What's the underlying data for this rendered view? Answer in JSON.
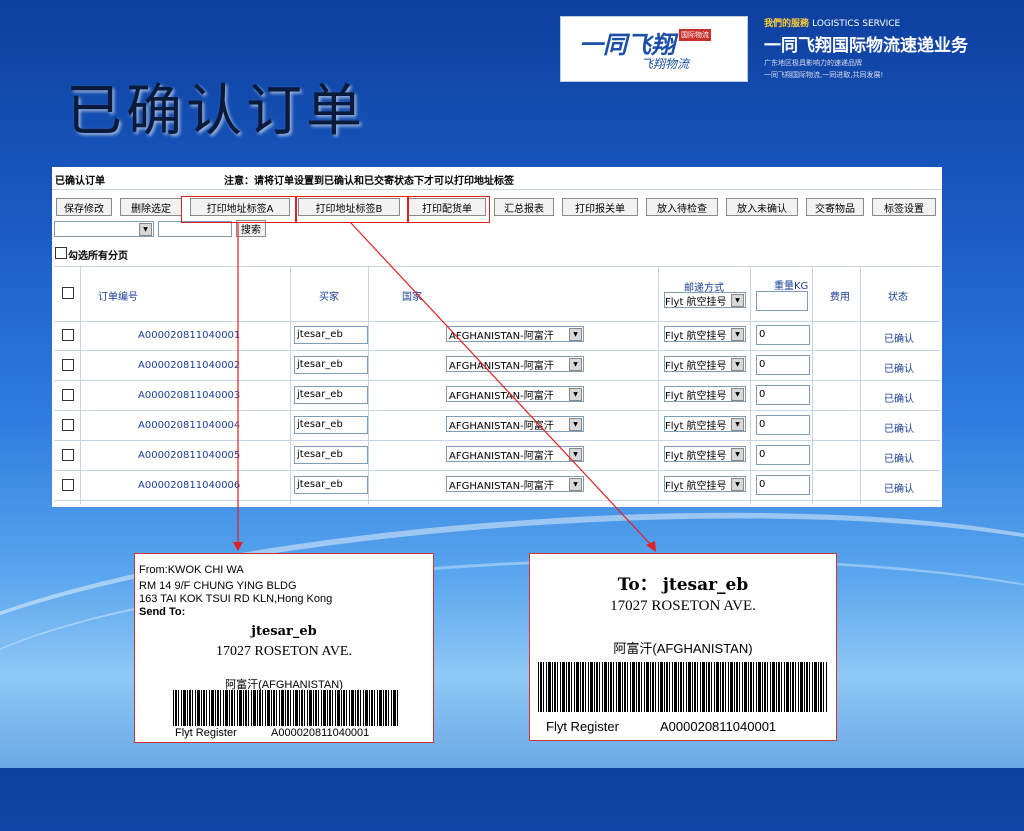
{
  "slide_title": "已确认订单",
  "logo": {
    "main": "一同飞翔",
    "sub": "飞翔物流",
    "tag": "国际物流"
  },
  "brand": {
    "line1": "我們的服務",
    "line1_en": "LOGISTICS SERVICE",
    "line2": "一同飞翔国际物流速递业务",
    "line3": "广东地区极具影响力的速递品牌",
    "line4": "一同飞翔国际物流,一同进取,共同发展!"
  },
  "panel": {
    "title": "已确认订单",
    "notice": "注意：请将订单设置到已确认和已交寄状态下才可以打印地址标签",
    "toolbar": [
      "保存修改",
      "删除选定",
      "打印地址标签A",
      "打印地址标签B",
      "打印配货单",
      "汇总报表",
      "打印报关单",
      "放入待检查",
      "放入未确认",
      "交寄物品",
      "标签设置"
    ],
    "search_button": "搜索",
    "select_all": "勾选所有分页"
  },
  "table": {
    "headers": {
      "order_no": "订单编号",
      "buyer": "买家",
      "country": "国家",
      "shipping": "邮递方式",
      "weight": "重量KG",
      "fee": "费用",
      "status": "状态",
      "shipping_select": "Flyt 航空挂号"
    },
    "rows": [
      {
        "order": "A000020811040001",
        "buyer": "jtesar_eb",
        "country": "AFGHANISTAN-阿富汗",
        "shipping": "Flyt 航空挂号",
        "weight": "0",
        "status": "已确认"
      },
      {
        "order": "A000020811040002",
        "buyer": "jtesar_eb",
        "country": "AFGHANISTAN-阿富汗",
        "shipping": "Flyt 航空挂号",
        "weight": "0",
        "status": "已确认"
      },
      {
        "order": "A000020811040003",
        "buyer": "jtesar_eb",
        "country": "AFGHANISTAN-阿富汗",
        "shipping": "Flyt 航空挂号",
        "weight": "0",
        "status": "已确认"
      },
      {
        "order": "A000020811040004",
        "buyer": "jtesar_eb",
        "country": "AFGHANISTAN-阿富汗",
        "shipping": "Flyt 航空挂号",
        "weight": "0",
        "status": "已确认"
      },
      {
        "order": "A000020811040005",
        "buyer": "jtesar_eb",
        "country": "AFGHANISTAN-阿富汗",
        "shipping": "Flyt 航空挂号",
        "weight": "0",
        "status": "已确认"
      },
      {
        "order": "A000020811040006",
        "buyer": "jtesar_eb",
        "country": "AFGHANISTAN-阿富汗",
        "shipping": "Flyt 航空挂号",
        "weight": "0",
        "status": "已确认"
      }
    ]
  },
  "label_a": {
    "from": "From:KWOK CHI WA",
    "addr1": "RM 14 9/F CHUNG YING BLDG",
    "addr2": "163 TAI KOK TSUI RD KLN,Hong Kong",
    "send_to": "Send To:",
    "name": "jtesar_eb",
    "street": "17027 ROSETON AVE.",
    "country": "阿富汗(AFGHANISTAN)",
    "footer_left": "Flyt Register",
    "footer_right": "A000020811040001"
  },
  "label_b": {
    "to": "To： jtesar_eb",
    "street": "17027 ROSETON AVE.",
    "country": "阿富汗(AFGHANISTAN)",
    "footer_left": "Flyt Register",
    "footer_right": "A000020811040001"
  },
  "colors": {
    "accent_red": "#e02020",
    "link_blue": "#1a3f9a",
    "brand_yellow": "#ffcc33"
  }
}
